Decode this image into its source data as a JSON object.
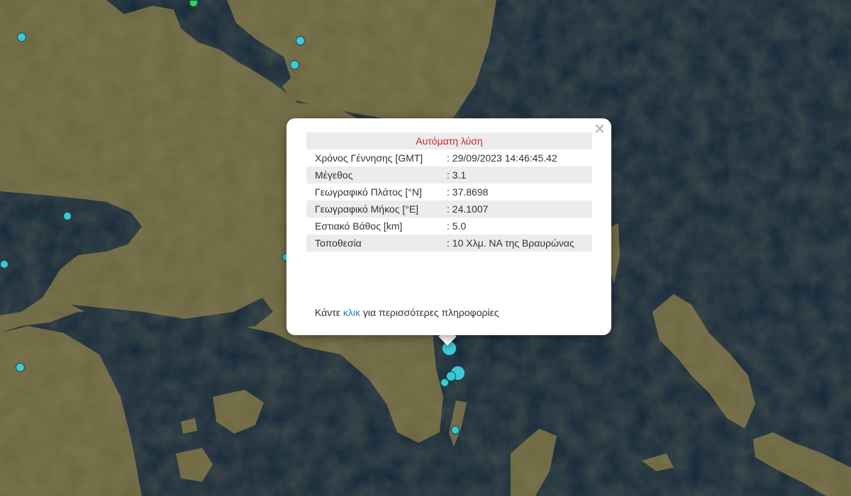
{
  "popup": {
    "title": "Αυτόματη λύση",
    "close_symbol": "×",
    "rows": [
      {
        "label": "Χρόνος Γέννησης [GMT]",
        "value": ": 29/09/2023 14:46:45.42"
      },
      {
        "label": "Μέγεθος",
        "value": ": 3.1"
      },
      {
        "label": "Γεωγραφικό Πλάτος [°N]",
        "value": ": 37.8698"
      },
      {
        "label": "Γεωγραφικό Μήκος [°E]",
        "value": ": 24.1007"
      },
      {
        "label": "Εστιακό Βάθος [km]",
        "value": ": 5.0"
      },
      {
        "label": "Τοποθεσία",
        "value": ": 10 Χλμ. ΝΑ της Βραυρώνας"
      }
    ],
    "more_prefix": "Κάντε ",
    "more_link": "κλικ",
    "more_suffix": " για περισσότερες πληροφορίες"
  },
  "colors": {
    "sea": "#13273a",
    "land": "#6b6640",
    "marker_cyan": "#3fc8d6",
    "marker_green": "#37c96a",
    "popup_title": "#c62828",
    "link": "#1a7fb5"
  }
}
